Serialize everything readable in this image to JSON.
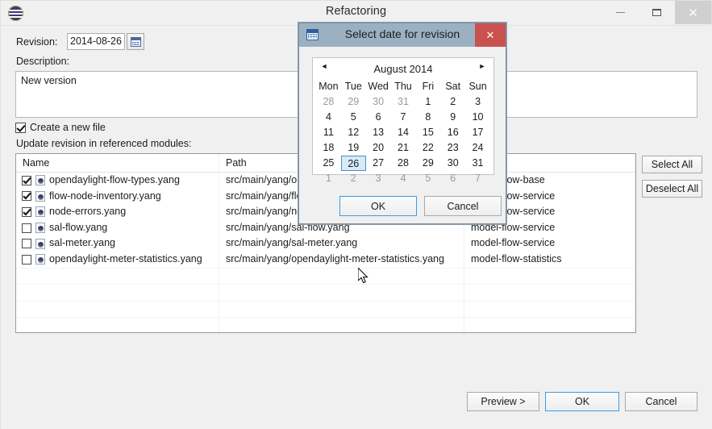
{
  "window": {
    "title": "Refactoring",
    "app_icon": "eclipse-icon",
    "controls": {
      "minimize": "–",
      "maximize": "□",
      "close": "✕"
    }
  },
  "form": {
    "revision_label": "Revision:",
    "revision_value": "2014-08-26",
    "revision_picker_icon": "calendar-icon",
    "description_label": "Description:",
    "description_value": "New version",
    "create_new_file_label": "Create a new file",
    "create_new_file_checked": true,
    "update_modules_label": "Update revision in referenced modules:"
  },
  "table": {
    "columns": [
      "Name",
      "Path",
      ""
    ],
    "rows": [
      {
        "checked": true,
        "name": "opendaylight-flow-types.yang",
        "path": "src/main/yang/opendaylight-flow-types.yang",
        "model": "model-flow-base"
      },
      {
        "checked": true,
        "name": "flow-node-inventory.yang",
        "path": "src/main/yang/flow-node-inventory.yang",
        "model": "model-flow-service"
      },
      {
        "checked": true,
        "name": "node-errors.yang",
        "path": "src/main/yang/node-errors.yang",
        "model": "model-flow-service"
      },
      {
        "checked": false,
        "name": "sal-flow.yang",
        "path": "src/main/yang/sal-flow.yang",
        "model": "model-flow-service"
      },
      {
        "checked": false,
        "name": "sal-meter.yang",
        "path": "src/main/yang/sal-meter.yang",
        "model": "model-flow-service"
      },
      {
        "checked": false,
        "name": "opendaylight-meter-statistics.yang",
        "path": "src/main/yang/opendaylight-meter-statistics.yang",
        "model": "model-flow-statistics"
      }
    ],
    "empty_row_count": 4
  },
  "side_buttons": {
    "select_all": "Select All",
    "deselect_all": "Deselect All"
  },
  "bottom_buttons": {
    "preview": "Preview >",
    "ok": "OK",
    "cancel": "Cancel"
  },
  "dialog": {
    "title": "Select date for revision",
    "icon": "calendar-icon",
    "close": "✕",
    "calendar": {
      "prev_icon": "◄",
      "next_icon": "►",
      "month_label": "August 2014",
      "day_names": [
        "Mon",
        "Tue",
        "Wed",
        "Thu",
        "Fri",
        "Sat",
        "Sun"
      ],
      "selected_day": 26,
      "weeks": [
        [
          {
            "d": 28,
            "o": true
          },
          {
            "d": 29,
            "o": true
          },
          {
            "d": 30,
            "o": true
          },
          {
            "d": 31,
            "o": true
          },
          {
            "d": 1,
            "o": false
          },
          {
            "d": 2,
            "o": false
          },
          {
            "d": 3,
            "o": false
          }
        ],
        [
          {
            "d": 4,
            "o": false
          },
          {
            "d": 5,
            "o": false
          },
          {
            "d": 6,
            "o": false
          },
          {
            "d": 7,
            "o": false
          },
          {
            "d": 8,
            "o": false
          },
          {
            "d": 9,
            "o": false
          },
          {
            "d": 10,
            "o": false
          }
        ],
        [
          {
            "d": 11,
            "o": false
          },
          {
            "d": 12,
            "o": false
          },
          {
            "d": 13,
            "o": false
          },
          {
            "d": 14,
            "o": false
          },
          {
            "d": 15,
            "o": false
          },
          {
            "d": 16,
            "o": false
          },
          {
            "d": 17,
            "o": false
          }
        ],
        [
          {
            "d": 18,
            "o": false
          },
          {
            "d": 19,
            "o": false
          },
          {
            "d": 20,
            "o": false
          },
          {
            "d": 21,
            "o": false
          },
          {
            "d": 22,
            "o": false
          },
          {
            "d": 23,
            "o": false
          },
          {
            "d": 24,
            "o": false
          }
        ],
        [
          {
            "d": 25,
            "o": false
          },
          {
            "d": 26,
            "o": false,
            "sel": true
          },
          {
            "d": 27,
            "o": false
          },
          {
            "d": 28,
            "o": false
          },
          {
            "d": 29,
            "o": false
          },
          {
            "d": 30,
            "o": false
          },
          {
            "d": 31,
            "o": false
          }
        ],
        [
          {
            "d": 1,
            "o": true
          },
          {
            "d": 2,
            "o": true
          },
          {
            "d": 3,
            "o": true
          },
          {
            "d": 4,
            "o": true
          },
          {
            "d": 5,
            "o": true
          },
          {
            "d": 6,
            "o": true
          },
          {
            "d": 7,
            "o": true
          }
        ]
      ]
    },
    "ok": "OK",
    "cancel": "Cancel"
  },
  "colors": {
    "dialog_titlebar": "#9bb0c1",
    "dialog_close": "#c9524f",
    "focus_border": "#3d9ae8",
    "selected_day_bg": "#d6eaf8",
    "window_bg": "#f0f0f0"
  }
}
